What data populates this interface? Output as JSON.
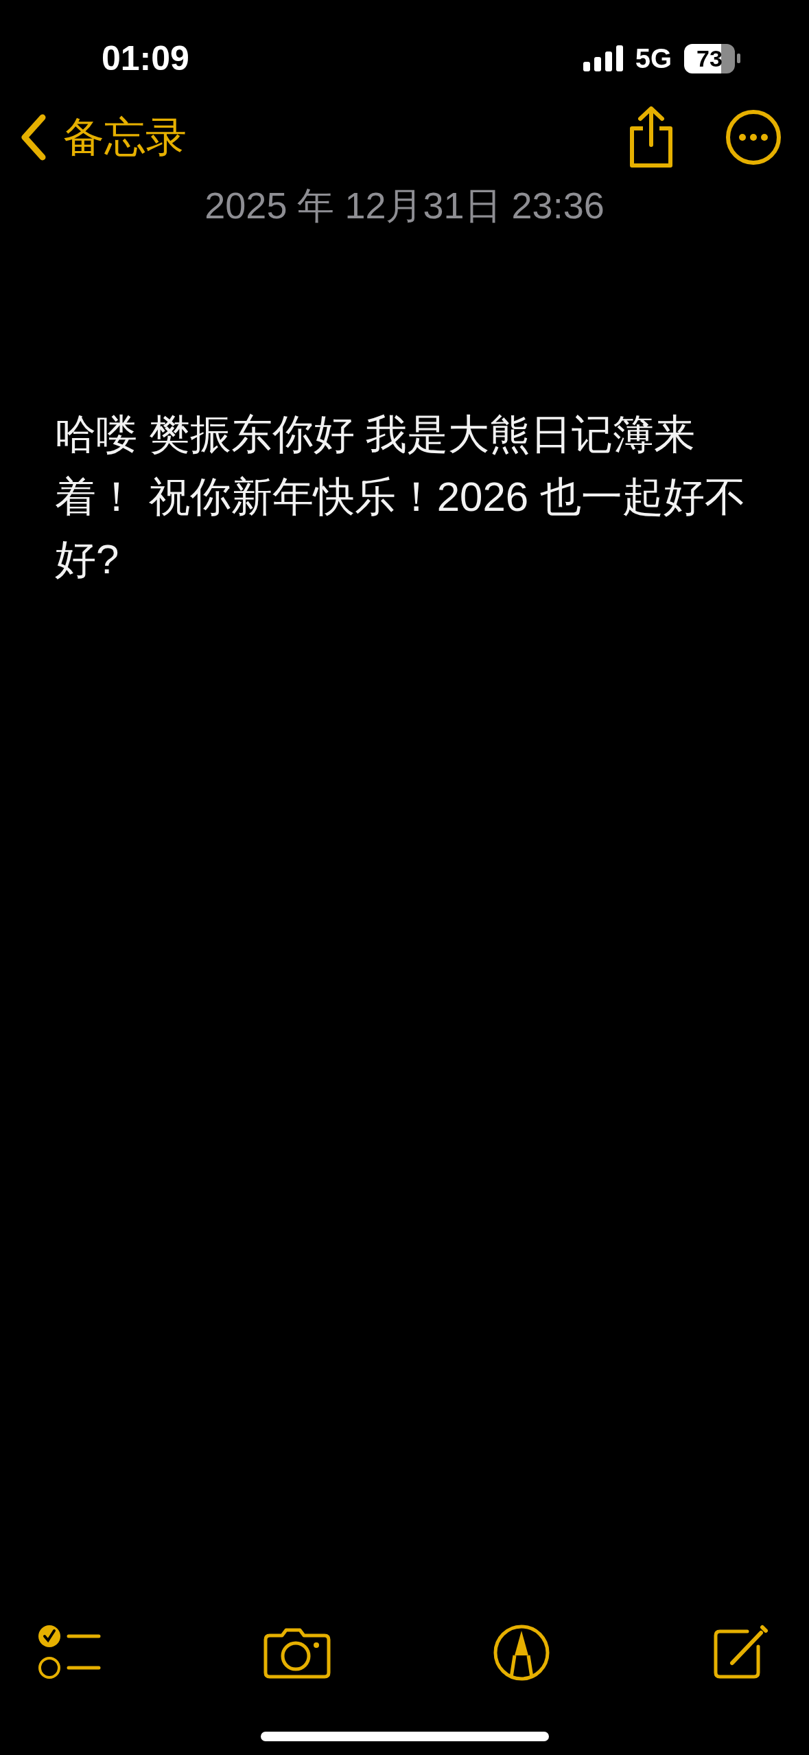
{
  "status_bar": {
    "time": "01:09",
    "network": "5G",
    "battery": "73"
  },
  "nav": {
    "back_label": "备忘录"
  },
  "note": {
    "date": "2025 年 12月31日 23:36",
    "body": "哈喽 樊振东你好 我是大熊日记簿来着！ 祝你新年快乐！2026 也一起好不好?"
  }
}
